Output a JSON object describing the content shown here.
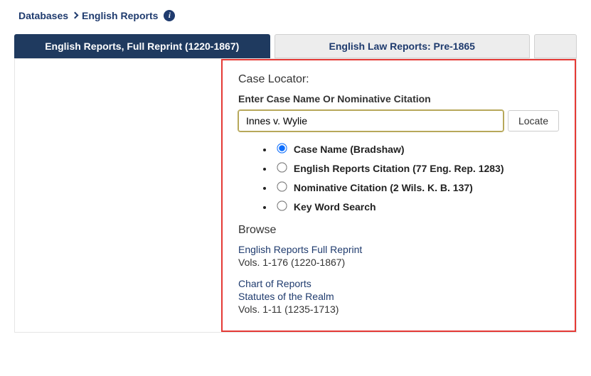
{
  "breadcrumb": {
    "root": "Databases",
    "current": "English Reports"
  },
  "tabs": [
    {
      "label": "English Reports, Full Reprint (1220-1867)",
      "active": true
    },
    {
      "label": "English Law Reports: Pre-1865",
      "active": false
    },
    {
      "label": "",
      "active": false
    }
  ],
  "case_locator": {
    "heading": "Case Locator:",
    "prompt": "Enter Case Name Or Nominative Citation",
    "input_value": "Innes v. Wylie",
    "locate_label": "Locate",
    "options": [
      {
        "label": "Case Name (Bradshaw)",
        "checked": true
      },
      {
        "label": "English Reports Citation (77 Eng. Rep. 1283)",
        "checked": false
      },
      {
        "label": "Nominative Citation (2 Wils. K. B. 137)",
        "checked": false
      },
      {
        "label": "Key Word Search",
        "checked": false
      }
    ]
  },
  "browse": {
    "heading": "Browse",
    "items": [
      {
        "link": "English Reports Full Reprint",
        "meta": "Vols. 1-176 (1220-1867)"
      },
      {
        "link": "Chart of Reports",
        "meta": ""
      },
      {
        "link": "Statutes of the Realm",
        "meta": "Vols. 1-11 (1235-1713)"
      }
    ]
  }
}
